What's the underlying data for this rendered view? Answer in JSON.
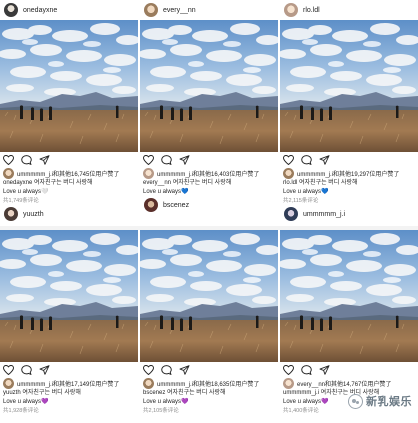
{
  "posts": [
    {
      "username": "onedayxne",
      "likes_text": "ummmmm_j.i和其他16,745位用户赞了",
      "caption_user": "onedayxne",
      "caption_text": "여자친구는 버디 사랑해",
      "caption_line2": "Love u always",
      "heart": "🤍",
      "comments_text": "共1,749条评论",
      "commenter": "yuuzth"
    },
    {
      "username": "every__nn",
      "likes_text": "ummmmm_j.i和其他16,403位用户赞了",
      "caption_user": "every__nn",
      "caption_text": "여자친구는 버디 사랑해",
      "caption_line2": "Love u always",
      "heart": "💙",
      "comments_text": "",
      "commenter": "bscenez"
    },
    {
      "username": "rlo.ldl",
      "likes_text": "ummmmm_j.i和其他19,297位用户赞了",
      "caption_user": "rlo.ldl",
      "caption_text": "여자친구는 버디 사랑해",
      "caption_line2": "Love u always",
      "heart": "💙",
      "comments_text": "共2,115条评论",
      "commenter": "ummmmm_j.i"
    },
    {
      "username": "",
      "likes_text": "ummmmm_j.i和其他17,149位用户赞了",
      "caption_user": "yuuzth",
      "caption_text": "여자친구는 버디 사랑해",
      "caption_line2": "Love u always",
      "heart": "💜",
      "comments_text": "共1,928条评论",
      "commenter": ""
    },
    {
      "username": "",
      "likes_text": "ummmmm_j.i和其他18,635位用户赞了",
      "caption_user": "bscenez",
      "caption_text": "여자친구는 버디 사랑해",
      "caption_line2": "Love u always",
      "heart": "💜",
      "comments_text": "共2,105条评论",
      "commenter": ""
    },
    {
      "username": "",
      "likes_text": "every__nn和其他14,767位用户赞了",
      "caption_user": "ummmmm_j.i",
      "caption_text": "여자친구는 버디 사랑해",
      "caption_line2": "Love u always",
      "heart": "💜",
      "comments_text": "共1,400条评论",
      "commenter": ""
    }
  ],
  "watermark": {
    "text": "新乳娱乐"
  },
  "colors": {
    "heart_blue": "#3b8ad9",
    "heart_purple": "#8e44ad",
    "bg": "#ffffff"
  }
}
